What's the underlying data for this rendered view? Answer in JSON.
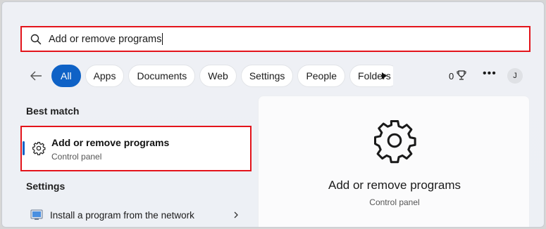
{
  "search": {
    "query": "Add or remove programs"
  },
  "filters": {
    "items": [
      {
        "label": "All",
        "active": true
      },
      {
        "label": "Apps",
        "active": false
      },
      {
        "label": "Documents",
        "active": false
      },
      {
        "label": "Web",
        "active": false
      },
      {
        "label": "Settings",
        "active": false
      },
      {
        "label": "People",
        "active": false
      },
      {
        "label": "Folders",
        "active": false
      }
    ],
    "points": "0",
    "avatar_initial": "J"
  },
  "results": {
    "best_match_label": "Best match",
    "best_match": {
      "title": "Add or remove programs",
      "subtitle": "Control panel",
      "icon": "gear-icon"
    },
    "settings_label": "Settings",
    "settings_items": [
      {
        "label": "Install a program from the network",
        "icon": "network-program-icon"
      }
    ]
  },
  "detail": {
    "title": "Add or remove programs",
    "subtitle": "Control panel",
    "icon": "gear-icon"
  },
  "colors": {
    "accent": "#0f62c6",
    "highlight_border": "#e3141b"
  }
}
